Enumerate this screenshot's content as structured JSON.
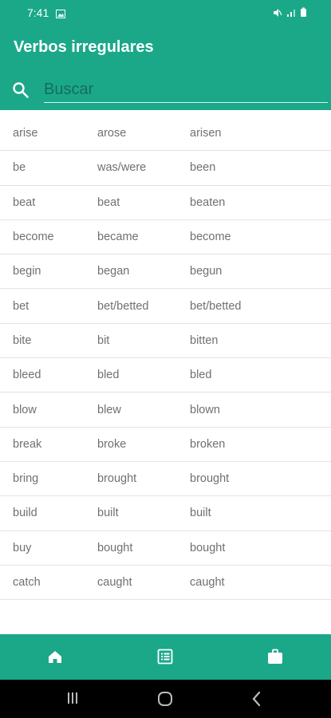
{
  "status_bar": {
    "time": "7:41"
  },
  "app_bar": {
    "title": "Verbos irregulares"
  },
  "search": {
    "placeholder": "Buscar",
    "value": ""
  },
  "verbs": [
    [
      "arise",
      "arose",
      "arisen"
    ],
    [
      "be",
      "was/were",
      "been"
    ],
    [
      "beat",
      "beat",
      "beaten"
    ],
    [
      "become",
      "became",
      "become"
    ],
    [
      "begin",
      "began",
      "begun"
    ],
    [
      "bet",
      "bet/betted",
      "bet/betted"
    ],
    [
      "bite",
      "bit",
      "bitten"
    ],
    [
      "bleed",
      "bled",
      "bled"
    ],
    [
      "blow",
      "blew",
      "blown"
    ],
    [
      "break",
      "broke",
      "broken"
    ],
    [
      "bring",
      "brought",
      "brought"
    ],
    [
      "build",
      "built",
      "built"
    ],
    [
      "buy",
      "bought",
      "bought"
    ],
    [
      "catch",
      "caught",
      "caught"
    ]
  ],
  "colors": {
    "primary": "#1aa889",
    "text": "#707070",
    "divider": "#e3e3e3"
  },
  "bottom_nav": [
    "home-icon",
    "list-icon",
    "briefcase-icon"
  ]
}
